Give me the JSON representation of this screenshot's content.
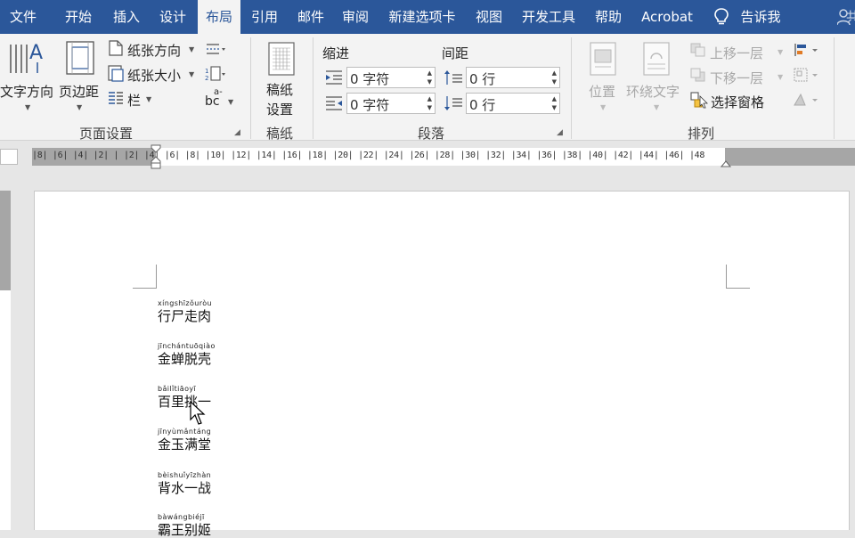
{
  "tabs": [
    {
      "label": "文件",
      "active": false
    },
    {
      "label": "开始",
      "active": false
    },
    {
      "label": "插入",
      "active": false
    },
    {
      "label": "设计",
      "active": false
    },
    {
      "label": "布局",
      "active": true
    },
    {
      "label": "引用",
      "active": false
    },
    {
      "label": "邮件",
      "active": false
    },
    {
      "label": "审阅",
      "active": false
    },
    {
      "label": "新建选项卡",
      "active": false
    },
    {
      "label": "视图",
      "active": false
    },
    {
      "label": "开发工具",
      "active": false
    },
    {
      "label": "帮助",
      "active": false
    },
    {
      "label": "Acrobat",
      "active": false
    },
    {
      "label": "告诉我",
      "active": false
    }
  ],
  "user_fragment": "共",
  "ribbon": {
    "page_setup": {
      "text_direction": "文字方向",
      "margins": "页边距",
      "orientation": "纸张方向",
      "size": "纸张大小",
      "columns": "栏",
      "hyphenation": "bc",
      "group_label": "页面设置"
    },
    "manuscript": {
      "button_line1": "稿纸",
      "button_line2": "设置",
      "group_label": "稿纸"
    },
    "paragraph": {
      "indent_label": "缩进",
      "spacing_label": "间距",
      "indent_left": "0 字符",
      "indent_right": "0 字符",
      "spacing_before": "0 行",
      "spacing_after": "0 行",
      "group_label": "段落"
    },
    "arrange": {
      "position": "位置",
      "wrap_text": "环绕文字",
      "bring_forward": "上移一层",
      "send_backward": "下移一层",
      "selection_pane": "选择窗格",
      "group_label": "排列"
    }
  },
  "ruler": {
    "numbers": "|8|  |6|  |4|  |2|  |    |2|  |4|  |6|  |8|  |10|  |12|  |14|  |16|  |18|  |20|  |22|  |24|  |26|  |28|  |30|  |32|  |34|  |36|  |38|  |40|  |42|  |44|  |46|  |48"
  },
  "document": {
    "entries": [
      {
        "pinyin": "xíngshīzǒuròu",
        "word": "行尸走肉"
      },
      {
        "pinyin": "jīnchántuōqiào",
        "word": "金蝉脱壳"
      },
      {
        "pinyin": "bǎilǐtiāoyī",
        "word": "百里挑一"
      },
      {
        "pinyin": "jīnyùmǎntáng",
        "word": "金玉满堂"
      },
      {
        "pinyin": "bèishuǐyīzhàn",
        "word": "背水一战"
      },
      {
        "pinyin": "bàwángbiéjī",
        "word": "霸王别姬"
      }
    ]
  }
}
